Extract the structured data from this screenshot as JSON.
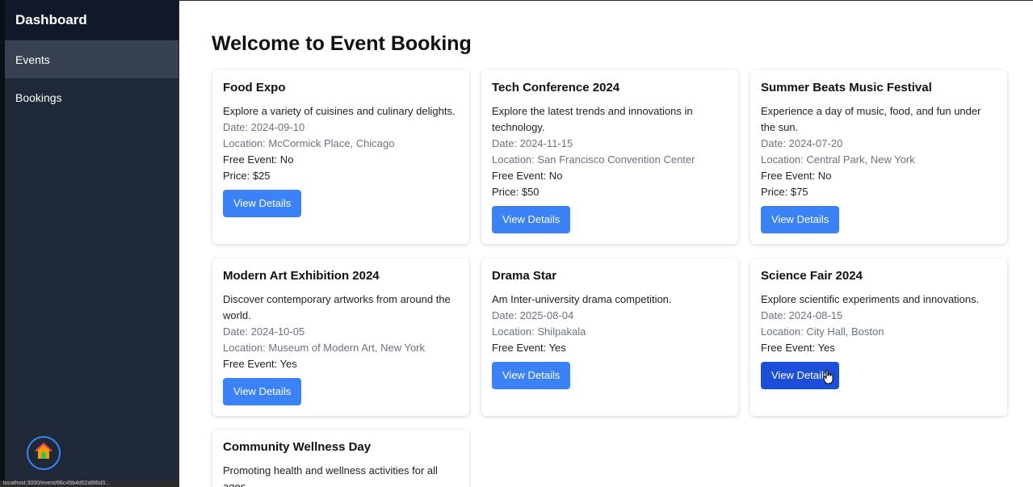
{
  "sidebar": {
    "title": "Dashboard",
    "items": [
      {
        "label": "Events"
      },
      {
        "label": "Bookings"
      }
    ],
    "home_icon": "home-icon"
  },
  "status_bar": {
    "url": "localhost:3000/event/66c45b4d52d6f6d3..."
  },
  "main": {
    "title": "Welcome to Event Booking"
  },
  "events": [
    {
      "title": "Food Expo",
      "description": "Explore a variety of cuisines and culinary delights.",
      "date": "Date: 2024-09-10",
      "location": "Location: McCormick Place, Chicago",
      "free": "Free Event: No",
      "price": "Price: $25",
      "button": "View Details"
    },
    {
      "title": "Tech Conference 2024",
      "description": "Explore the latest trends and innovations in technology.",
      "date": "Date: 2024-11-15",
      "location": "Location: San Francisco Convention Center",
      "free": "Free Event: No",
      "price": "Price: $50",
      "button": "View Details"
    },
    {
      "title": "Summer Beats Music Festival",
      "description": "Experience a day of music, food, and fun under the sun.",
      "date": "Date: 2024-07-20",
      "location": "Location: Central Park, New York",
      "free": "Free Event: No",
      "price": "Price: $75",
      "button": "View Details"
    },
    {
      "title": "Modern Art Exhibition 2024",
      "description": "Discover contemporary artworks from around the world.",
      "date": "Date: 2024-10-05",
      "location": "Location: Museum of Modern Art, New York",
      "free": "Free Event: Yes",
      "button": "View Details"
    },
    {
      "title": "Drama Star",
      "description": "Am Inter-university drama competition.",
      "date": "Date: 2025-08-04",
      "location": "Location: Shilpakala",
      "free": "Free Event: Yes",
      "button": "View Details"
    },
    {
      "title": "Science Fair 2024",
      "description": "Explore scientific experiments and innovations.",
      "date": "Date: 2024-08-15",
      "location": "Location: City Hall, Boston",
      "free": "Free Event: Yes",
      "button": "View Details"
    },
    {
      "title": "Community Wellness Day",
      "description": "Promoting health and wellness activities for all ages."
    }
  ],
  "colors": {
    "sidebar": "#1f2937",
    "sidebar_header": "#111827",
    "active_item": "#374151",
    "accent": "#3b82f6",
    "accent_hover": "#1d4ed8"
  }
}
